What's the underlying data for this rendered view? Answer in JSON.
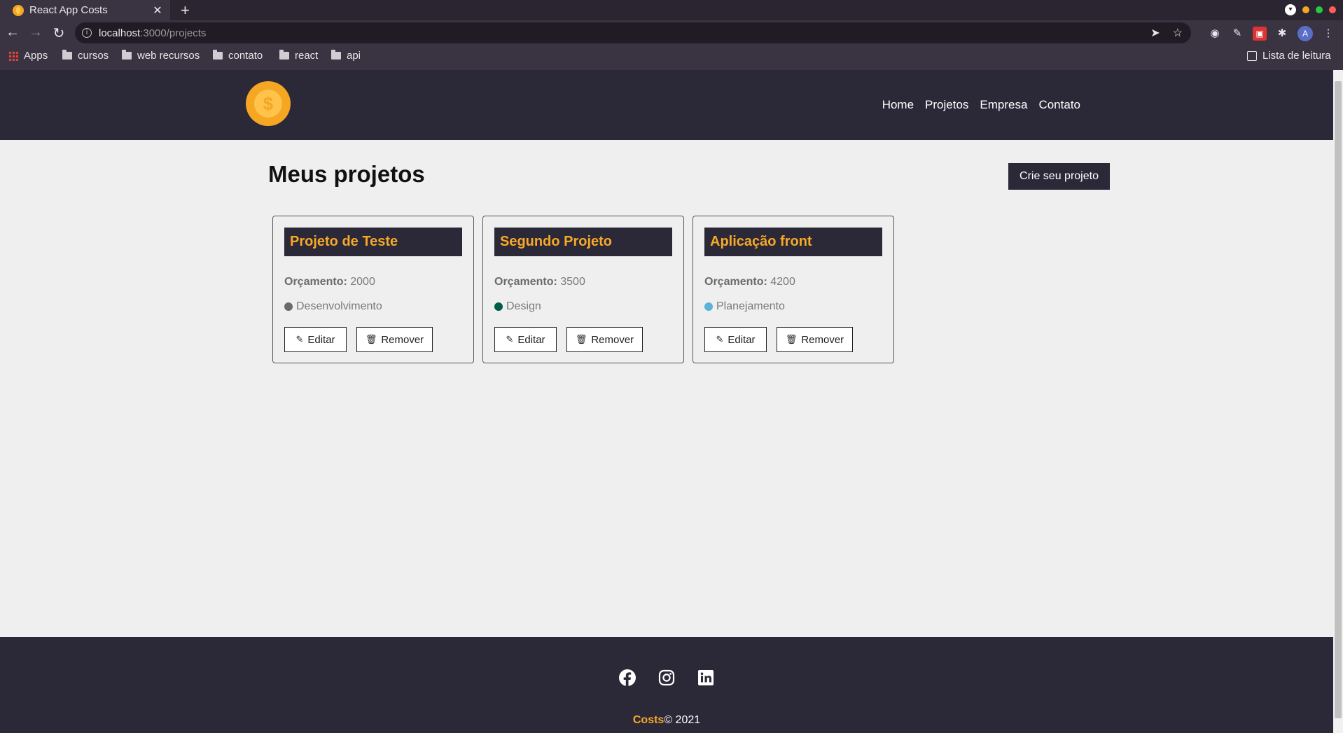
{
  "browser": {
    "tab_title": "React App Costs",
    "tab_close": "✕",
    "new_tab": "+",
    "url_host": "localhost",
    "url_path": ":3000/projects",
    "avatar_letter": "A",
    "bookmarks": [
      {
        "label": "Apps"
      },
      {
        "label": "cursos"
      },
      {
        "label": "web recursos"
      },
      {
        "label": "contato"
      },
      {
        "label": "react"
      },
      {
        "label": "api"
      }
    ],
    "reading_list": "Lista de leitura"
  },
  "navbar": {
    "logo_symbol": "$",
    "links": [
      "Home",
      "Projetos",
      "Empresa",
      "Contato"
    ]
  },
  "page": {
    "title": "Meus projetos",
    "create_button": "Crie seu projeto"
  },
  "projects": [
    {
      "name": "Projeto de Teste",
      "budget_label": "Orçamento:",
      "budget": "2000",
      "category": "Desenvolvimento",
      "category_color": "#6a6a6a",
      "edit_label": "Editar",
      "remove_label": "Remover"
    },
    {
      "name": "Segundo Projeto",
      "budget_label": "Orçamento:",
      "budget": "3500",
      "category": "Design",
      "category_color": "#005c4b",
      "edit_label": "Editar",
      "remove_label": "Remover"
    },
    {
      "name": "Aplicação front",
      "budget_label": "Orçamento:",
      "budget": "4200",
      "category": "Planejamento",
      "category_color": "#5ab4d6",
      "edit_label": "Editar",
      "remove_label": "Remover"
    }
  ],
  "footer": {
    "brand": "Costs",
    "copyright": "© 2021",
    "social_icons": [
      "facebook-icon",
      "instagram-icon",
      "linkedin-icon"
    ]
  },
  "colors": {
    "nav_bg": "#2b2838",
    "accent": "#f7a928",
    "page_bg": "#efefef"
  }
}
